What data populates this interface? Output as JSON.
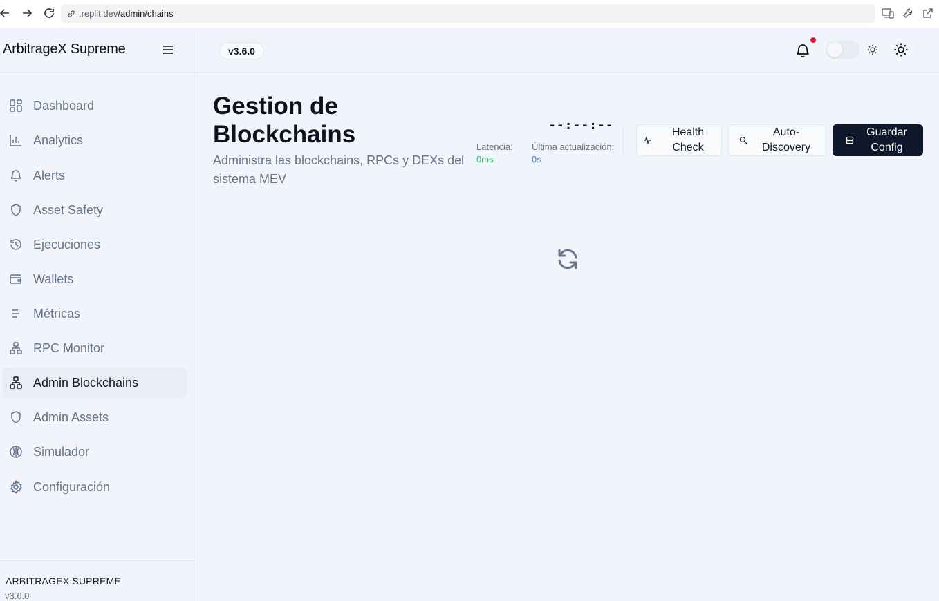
{
  "browser": {
    "url_host": ".replit.dev",
    "url_path": "/admin/chains"
  },
  "sidebar": {
    "app_title": "ArbitrageX Supreme",
    "items": [
      {
        "label": "Dashboard",
        "icon": "dashboard-icon"
      },
      {
        "label": "Analytics",
        "icon": "bar-chart-icon"
      },
      {
        "label": "Alerts",
        "icon": "bell-icon"
      },
      {
        "label": "Asset Safety",
        "icon": "shield-icon"
      },
      {
        "label": "Ejecuciones",
        "icon": "history-icon"
      },
      {
        "label": "Wallets",
        "icon": "wallet-icon"
      },
      {
        "label": "Métricas",
        "icon": "metrics-icon"
      },
      {
        "label": "RPC Monitor",
        "icon": "network-icon"
      },
      {
        "label": "Admin Blockchains",
        "icon": "network-icon",
        "active": true
      },
      {
        "label": "Admin Assets",
        "icon": "shield-icon"
      },
      {
        "label": "Simulador",
        "icon": "brain-icon"
      },
      {
        "label": "Configuración",
        "icon": "gear-icon"
      }
    ],
    "footer_title": "ARBITRAGEX SUPREME",
    "footer_version": "v3.6.0"
  },
  "header": {
    "version": "v3.6.0"
  },
  "main": {
    "title": "Gestion de Blockchains",
    "subtitle": "Administra las blockchains, RPCs y DEXs del sistema MEV",
    "clock": "--:--:--",
    "latency_label": "Latencia:",
    "latency_value": "0ms",
    "updated_label": "Última actualización:",
    "updated_value": "0s",
    "buttons": {
      "health_check": "Health Check",
      "auto_discovery": "Auto-Discovery",
      "save_config": "Guardar Config"
    }
  },
  "colors": {
    "accent_dark": "#0f172a",
    "latency_green": "#22c55e",
    "updated_blue": "#3b82f6",
    "notification_red": "#e11d2e"
  }
}
